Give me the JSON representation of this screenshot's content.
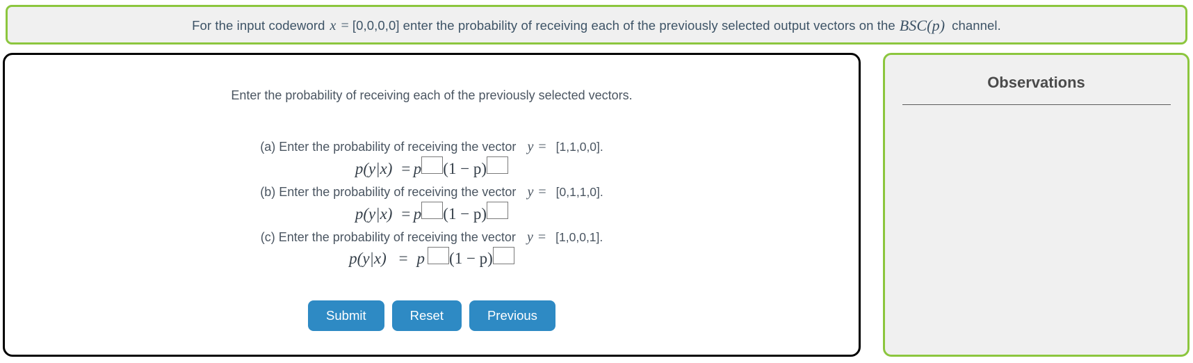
{
  "prompt": {
    "lead": "For the input codeword",
    "var_x": "x",
    "equals": "=",
    "codeword": "[0,0,0,0]",
    "middle": "enter the probability of receiving each of the previously selected output vectors on the",
    "channel_math": "BSC(p)",
    "tail": "channel."
  },
  "exercise": {
    "instruction": "Enter the probability of receiving each of the previously selected vectors.",
    "questions": [
      {
        "label": "(a) Enter the probability of receiving the vector",
        "var_y": "y",
        "equals": "=",
        "vector": "[1,1,0,0].",
        "formula": {
          "lhs": "p(y|x)",
          "equals": "=",
          "base1": "p",
          "exp1_value": "",
          "factor": "(1 − p)",
          "exp2_value": ""
        }
      },
      {
        "label": "(b) Enter the probability of receiving the vector",
        "var_y": "y",
        "equals": "=",
        "vector": "[0,1,1,0].",
        "formula": {
          "lhs": "p(y|x)",
          "equals": "=",
          "base1": "p",
          "exp1_value": "",
          "factor": "(1 − p)",
          "exp2_value": ""
        }
      },
      {
        "label": "(c) Enter the probability of receiving the vector",
        "var_y": "y",
        "equals": "=",
        "vector": "[1,0,0,1].",
        "formula": {
          "lhs": "p(y|x)",
          "equals": "=",
          "base1": "p",
          "exp1_value": "",
          "factor": "(1 − p)",
          "exp2_value": ""
        }
      }
    ],
    "buttons": {
      "submit": "Submit",
      "reset": "Reset",
      "previous": "Previous"
    }
  },
  "observations": {
    "title": "Observations",
    "content": ""
  },
  "colors": {
    "accent_green": "#8cc63e",
    "button_blue": "#2e8ac4",
    "panel_gray": "#f0f0f0",
    "text": "#4a5561"
  }
}
